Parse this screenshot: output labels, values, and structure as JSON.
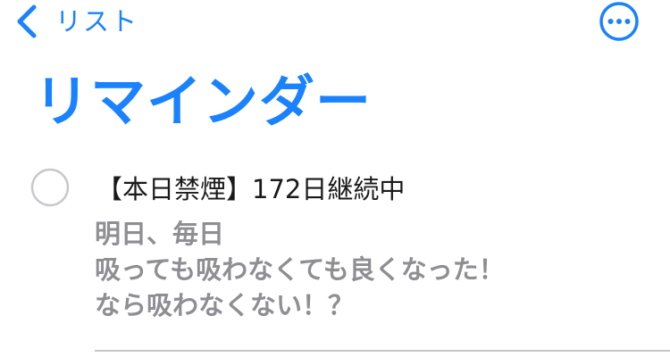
{
  "nav": {
    "back_label": "リスト",
    "back_icon": "chevron-left-icon",
    "more_icon": "ellipsis-circle-icon"
  },
  "page": {
    "title": "リマインダー"
  },
  "reminder": {
    "title": "【本日禁煙】172日継続中",
    "completed": false,
    "notes": [
      "明日、毎日",
      "吸っても吸わなくても良くなった！",
      "なら吸わなくない！？"
    ]
  },
  "colors": {
    "accent": "#1a82ff",
    "text_primary": "#1a1a1a",
    "text_secondary": "#8e8e93",
    "checkbox_border": "#c7c7cc"
  }
}
